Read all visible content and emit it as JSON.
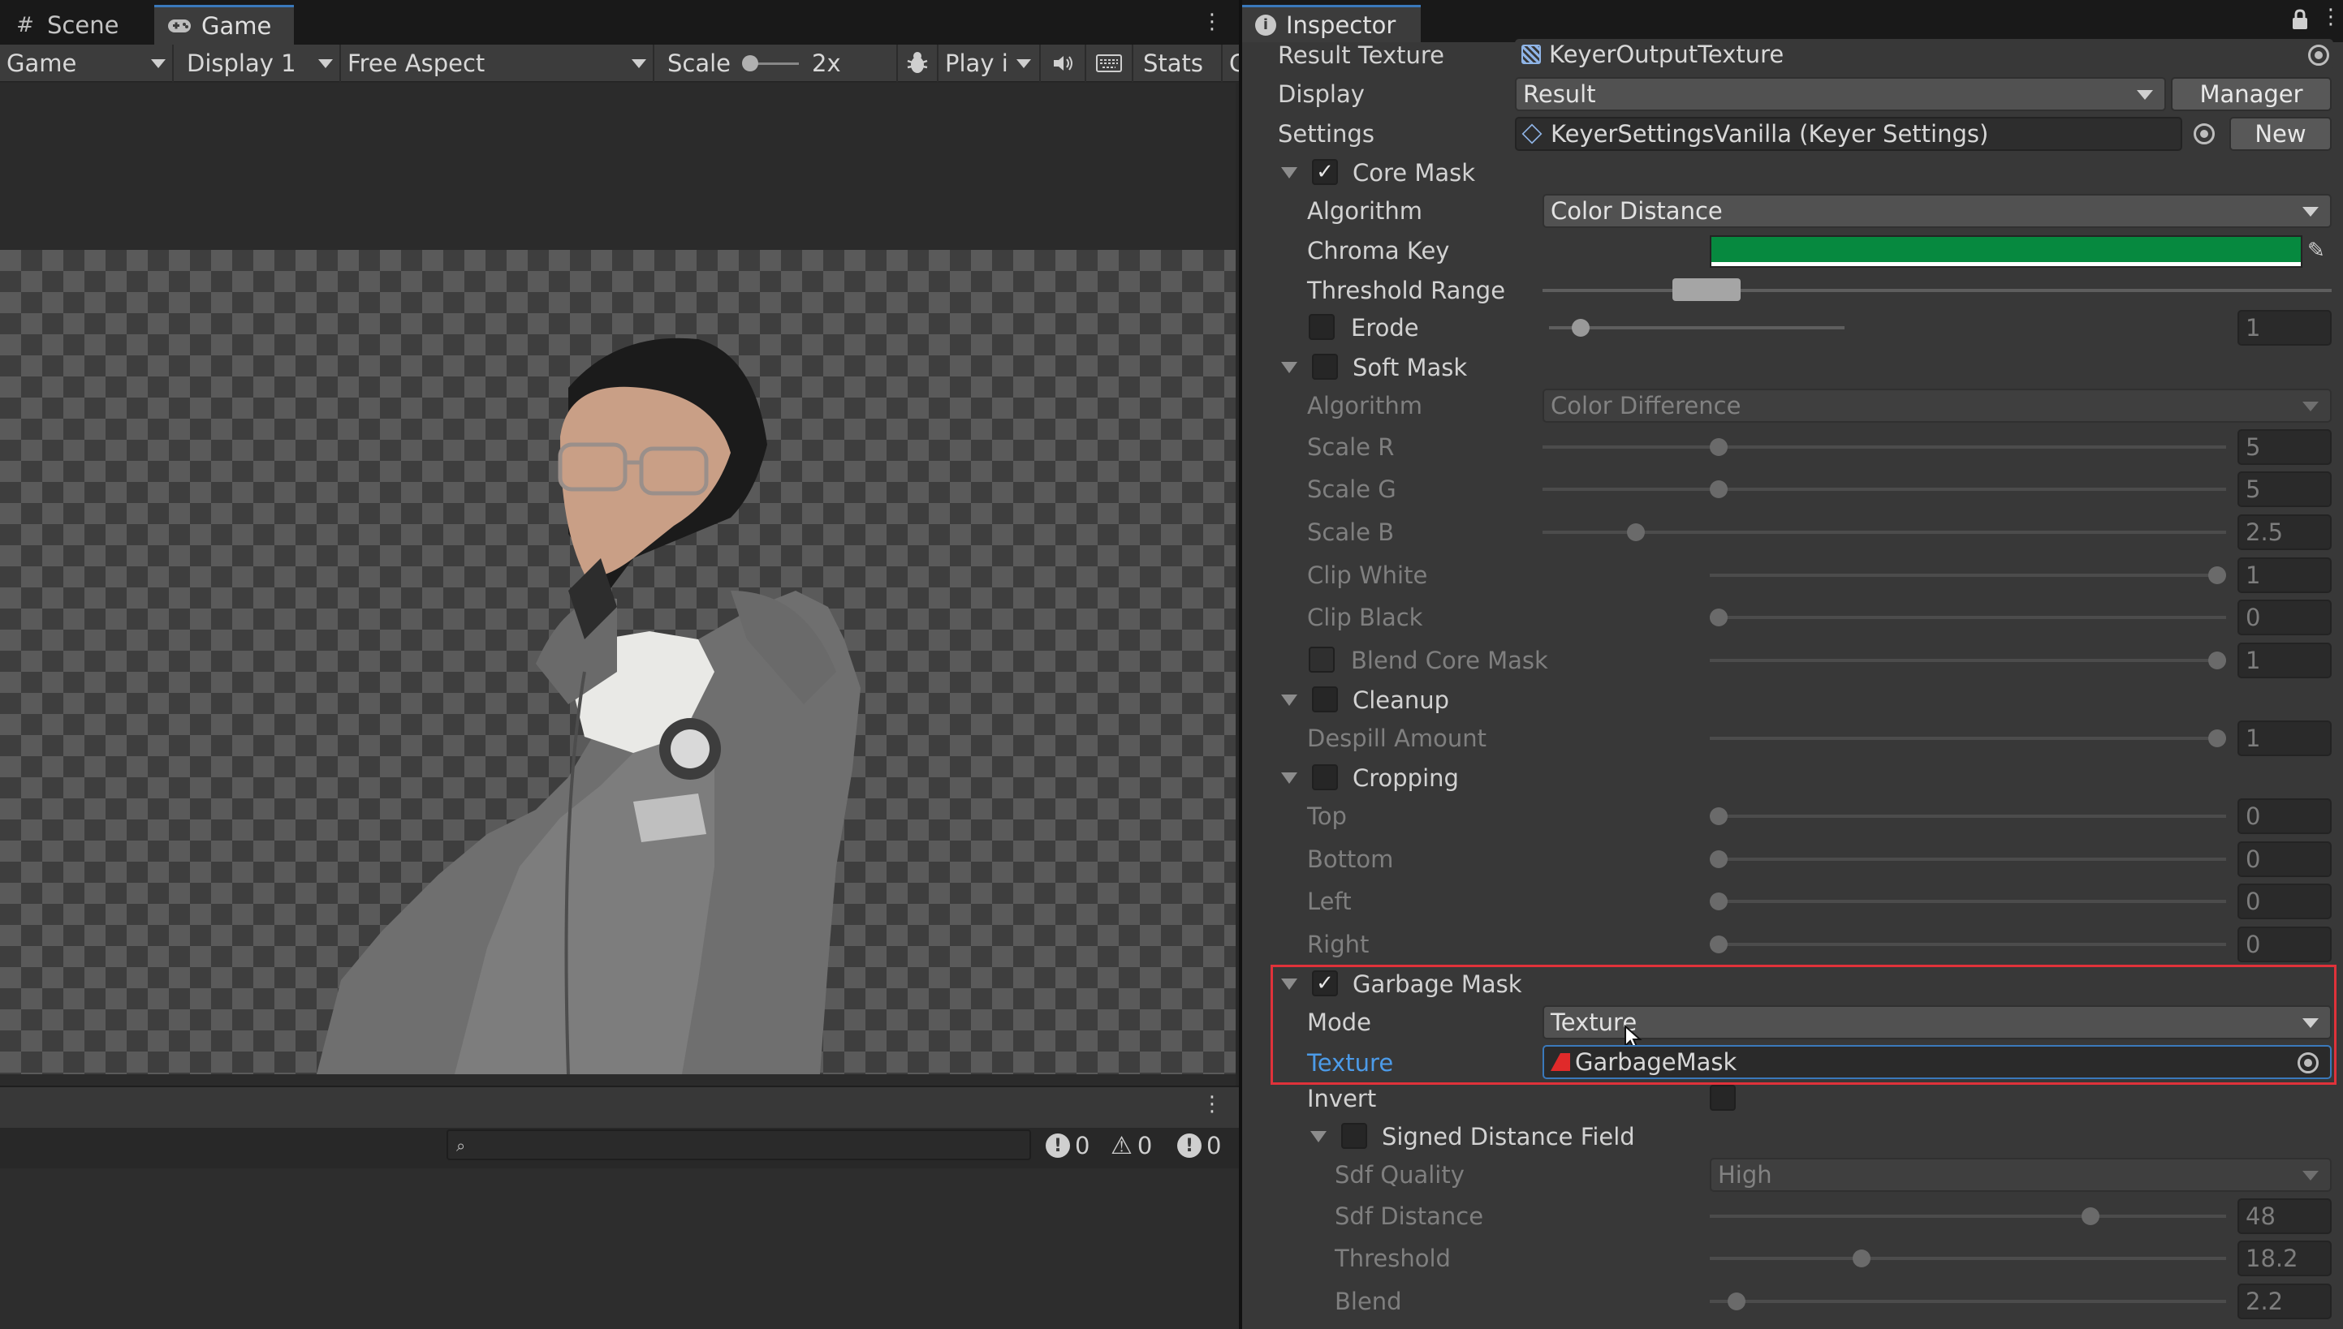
{
  "tabs_left": [
    {
      "label": "Scene",
      "icon": "grid-icon"
    },
    {
      "label": "Game",
      "icon": "gamepad-icon"
    }
  ],
  "game_toolbar": {
    "view": "Game",
    "display": "Display 1",
    "aspect": "Free Aspect",
    "scale_label": "Scale",
    "scale_value": "2x",
    "play": "Play i",
    "stats": "Stats",
    "gizmos_cut": "G"
  },
  "console": {
    "search_placeholder": "",
    "info_count": "0",
    "warning_count": "0",
    "error_count": "0"
  },
  "inspector": {
    "tab": "Inspector",
    "result_texture": {
      "label": "Result Texture",
      "value": "KeyerOutputTexture"
    },
    "display": {
      "label": "Display",
      "value": "Result",
      "button": "Manager"
    },
    "settings": {
      "label": "Settings",
      "value": "KeyerSettingsVanilla (Keyer Settings)",
      "button": "New"
    },
    "core_mask": {
      "title": "Core Mask",
      "enabled": true,
      "algorithm": {
        "label": "Algorithm",
        "value": "Color Distance"
      },
      "chroma_key": {
        "label": "Chroma Key",
        "color": "#06893f"
      },
      "threshold_range": {
        "label": "Threshold Range"
      },
      "erode": {
        "label": "Erode",
        "value": "1"
      }
    },
    "soft_mask": {
      "title": "Soft Mask",
      "enabled": false,
      "algorithm": {
        "label": "Algorithm",
        "value": "Color Difference"
      },
      "scale_r": {
        "label": "Scale R",
        "value": "5"
      },
      "scale_g": {
        "label": "Scale G",
        "value": "5"
      },
      "scale_b": {
        "label": "Scale B",
        "value": "2.5"
      },
      "clip_white": {
        "label": "Clip White",
        "value": "1"
      },
      "clip_black": {
        "label": "Clip Black",
        "value": "0"
      },
      "blend_core_mask": {
        "label": "Blend Core Mask",
        "value": "1"
      }
    },
    "cleanup": {
      "title": "Cleanup",
      "enabled": false,
      "despill": {
        "label": "Despill Amount",
        "value": "1"
      }
    },
    "cropping": {
      "title": "Cropping",
      "enabled": false,
      "top": {
        "label": "Top",
        "value": "0"
      },
      "bottom": {
        "label": "Bottom",
        "value": "0"
      },
      "left": {
        "label": "Left",
        "value": "0"
      },
      "right": {
        "label": "Right",
        "value": "0"
      }
    },
    "garbage_mask": {
      "title": "Garbage Mask",
      "enabled": true,
      "mode": {
        "label": "Mode",
        "value": "Texture"
      },
      "texture": {
        "label": "Texture",
        "value": "GarbageMask"
      },
      "invert": {
        "label": "Invert"
      },
      "sdf": {
        "title": "Signed Distance Field",
        "enabled": false,
        "quality": {
          "label": "Sdf Quality",
          "value": "High"
        },
        "distance": {
          "label": "Sdf Distance",
          "value": "48"
        },
        "threshold": {
          "label": "Threshold",
          "value": "18.2"
        },
        "blend": {
          "label": "Blend",
          "value": "2.2"
        }
      }
    }
  },
  "colors": {
    "accent": "#3a79bb",
    "highlight": "#e0323a",
    "link_label": "#4c9be8",
    "texture_icon": "#e02a2a"
  }
}
